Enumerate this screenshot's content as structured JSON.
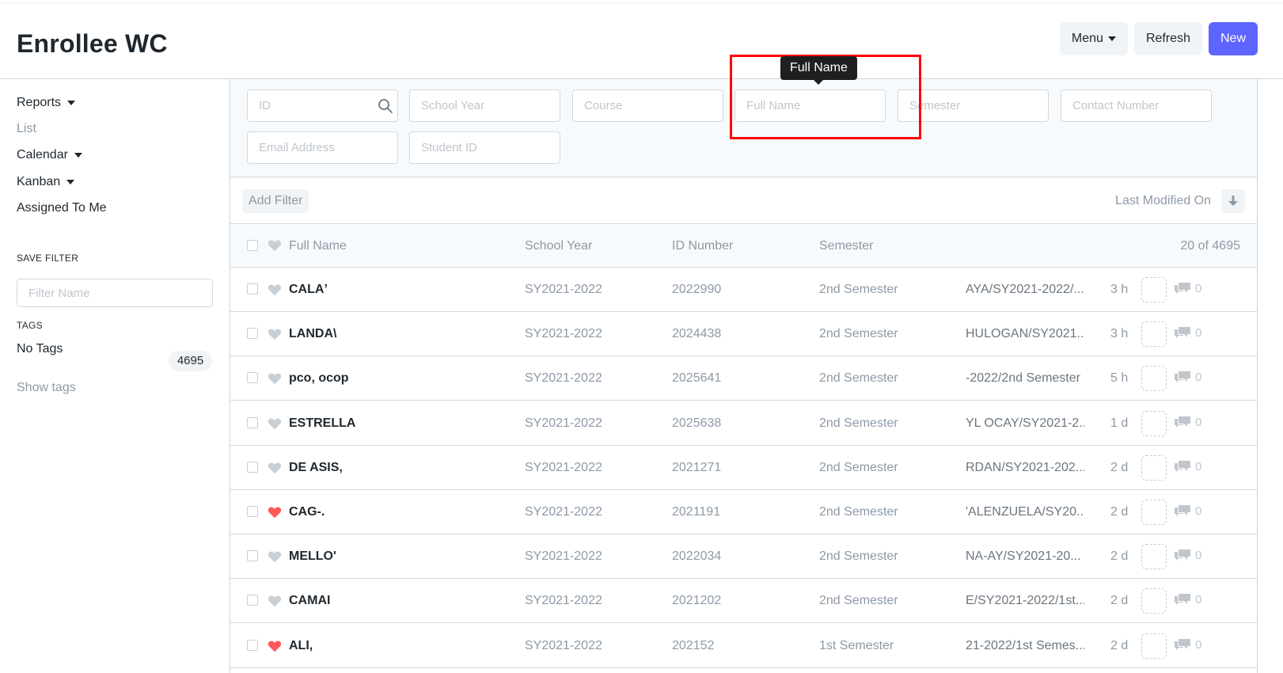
{
  "title": "Enrollee WC",
  "header_actions": {
    "menu": "Menu",
    "refresh": "Refresh",
    "new": "New"
  },
  "sidebar": {
    "links": [
      "Reports",
      "List",
      "Calendar",
      "Kanban",
      "Assigned To Me"
    ],
    "save_filter_heading": "SAVE FILTER",
    "filter_name_placeholder": "Filter Name",
    "tags_heading": "TAGS",
    "no_tags": "No Tags",
    "no_tags_count": "4695",
    "show_tags": "Show tags"
  },
  "filters": {
    "id": "ID",
    "school_year": "School Year",
    "course": "Course",
    "full_name": "Full Name",
    "semester": "Semester",
    "contact_number": "Contact Number",
    "email_address": "Email Address",
    "student_id": "Student ID"
  },
  "tooltip": "Full Name",
  "filter_bar": {
    "add_filter": "Add Filter",
    "sort_by": "Last Modified On"
  },
  "columns": {
    "full_name": "Full Name",
    "school_year": "School Year",
    "id_number": "ID Number",
    "semester": "Semester",
    "count": "20 of 4695"
  },
  "rows": [
    {
      "name": "CALAʼ",
      "school_year": "SY2021-2022",
      "id": "2022990",
      "semester": "2nd Semester",
      "trail": "AYA/SY2021-2022/...",
      "age": "3 h",
      "liked": false,
      "comments": "0"
    },
    {
      "name": "LANDA\\",
      "school_year": "SY2021-2022",
      "id": "2024438",
      "semester": "2nd Semester",
      "trail": "HULOGAN/SY2021...",
      "age": "3 h",
      "liked": false,
      "comments": "0"
    },
    {
      "name": "pco, ocop",
      "school_year": "SY2021-2022",
      "id": "2025641",
      "semester": "2nd Semester",
      "trail": "-2022/2nd Semester",
      "age": "5 h",
      "liked": false,
      "comments": "0"
    },
    {
      "name": "ESTRELLA",
      "school_year": "SY2021-2022",
      "id": "2025638",
      "semester": "2nd Semester",
      "trail": "YL OCAY/SY2021-2...",
      "age": "1 d",
      "liked": false,
      "comments": "0"
    },
    {
      "name": "DE ASIS,",
      "school_year": "SY2021-2022",
      "id": "2021271",
      "semester": "2nd Semester",
      "trail": "RDAN/SY2021-202...",
      "age": "2 d",
      "liked": false,
      "comments": "0"
    },
    {
      "name": "CAG-.",
      "school_year": "SY2021-2022",
      "id": "2021191",
      "semester": "2nd Semester",
      "trail": "'ALENZUELA/SY20...",
      "age": "2 d",
      "liked": true,
      "comments": "0"
    },
    {
      "name": "MELLO'",
      "school_year": "SY2021-2022",
      "id": "2022034",
      "semester": "2nd Semester",
      "trail": "NA-AY/SY2021-20...",
      "age": "2 d",
      "liked": false,
      "comments": "0"
    },
    {
      "name": "CAMAΙ",
      "school_year": "SY2021-2022",
      "id": "2021202",
      "semester": "2nd Semester",
      "trail": "E/SY2021-2022/1st...",
      "age": "2 d",
      "liked": false,
      "comments": "0"
    },
    {
      "name": "ALI,",
      "school_year": "SY2021-2022",
      "id": "202152",
      "semester": "1st Semester",
      "trail": "21-2022/1st Semes...",
      "age": "2 d",
      "liked": true,
      "comments": "0"
    }
  ],
  "colors": {
    "primary": "#5e64ff",
    "highlight": "#ff0000",
    "liked": "#ff5858",
    "unliked": "#c8cfd5"
  },
  "icons": [
    "search-icon",
    "caret-down-icon",
    "sort-arrow-icon",
    "heart-icon",
    "comment-icon"
  ]
}
